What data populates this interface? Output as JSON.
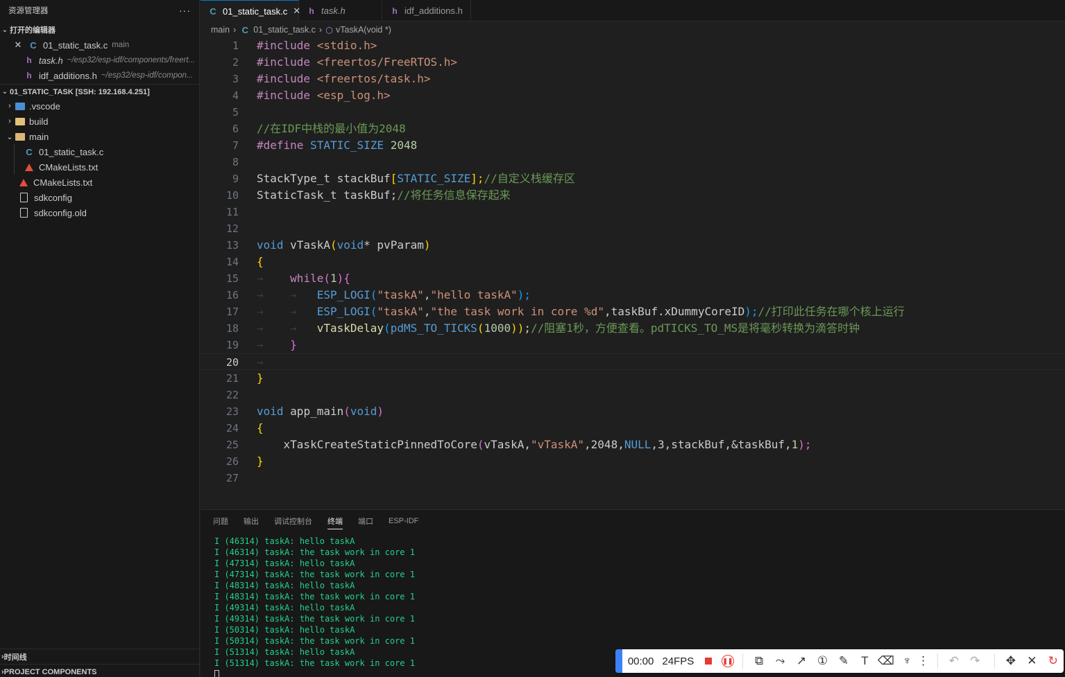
{
  "sidebar": {
    "title": "资源管理器",
    "more": "···",
    "open_editors_label": "打开的编辑器",
    "open_editors": [
      {
        "name": "01_static_task.c",
        "tag": "main",
        "icon": "c-file-icon",
        "close": "✕"
      },
      {
        "name": "task.h",
        "desc": "~/esp32/esp-idf/components/freert...",
        "icon": "h-file-icon"
      },
      {
        "name": "idf_additions.h",
        "desc": "~/esp32/esp-idf/compon...",
        "icon": "h-file-icon"
      }
    ],
    "workspace_label": "01_STATIC_TASK [SSH: 192.168.4.251]",
    "tree": [
      {
        "name": ".vscode"
      },
      {
        "name": "build"
      },
      {
        "name": "main"
      },
      {
        "name": "01_static_task.c"
      },
      {
        "name": "CMakeLists.txt"
      },
      {
        "name": "CMakeLists.txt"
      },
      {
        "name": "sdkconfig"
      },
      {
        "name": "sdkconfig.old"
      }
    ],
    "timeline_label": "时间线",
    "project_components_label": "PROJECT COMPONENTS"
  },
  "tabs": [
    {
      "label": "01_static_task.c",
      "close": "✕",
      "icon": "C"
    },
    {
      "label": "task.h",
      "icon": "h"
    },
    {
      "label": "idf_additions.h",
      "icon": "h"
    }
  ],
  "breadcrumb": {
    "folder": "main",
    "file": "01_static_task.c",
    "symbol": "vTaskA(void *)",
    "sep": "›"
  },
  "editor": {
    "line_numbers": [
      "1",
      "2",
      "3",
      "4",
      "5",
      "6",
      "7",
      "8",
      "9",
      "10",
      "11",
      "12",
      "13",
      "14",
      "15",
      "16",
      "17",
      "18",
      "19",
      "20",
      "21",
      "22",
      "23",
      "24",
      "25",
      "26",
      "27"
    ],
    "current_line": 20,
    "tokens": {
      "l1a": "#include",
      "l1b": "<stdio.h>",
      "l2a": "#include",
      "l2b": "<freertos/FreeRTOS.h>",
      "l3a": "#include",
      "l3b": "<freertos/task.h>",
      "l4a": "#include",
      "l4b": "<esp_log.h>",
      "l6": "//在IDF中栈的最小值为2048",
      "l7a": "#define",
      "l7b": "STATIC_SIZE",
      "l7c": "2048",
      "l9a": "StackType_t",
      "l9b": "stackBuf",
      "l9c": "[",
      "l9d": "STATIC_SIZE",
      "l9e": "];",
      "l9f": "//自定义栈缓存区",
      "l10a": "StaticTask_t",
      "l10b": "taskBuf;",
      "l10c": "//将任务信息保存起来",
      "l13a": "void",
      "l13b": "vTaskA",
      "l13c": "(",
      "l13d": "void",
      "l13e": "*",
      "l13f": "pvParam",
      "l13g": ")",
      "l14": "{",
      "l15a": "while",
      "l15b": "(",
      "l15c": "1",
      "l15d": ")",
      "l15e": "{",
      "l16a": "ESP_LOGI",
      "l16b": "(",
      "l16c": "\"taskA\"",
      "l16d": ",",
      "l16e": "\"hello taskA\"",
      "l16f": ");",
      "l17a": "ESP_LOGI",
      "l17b": "(",
      "l17c": "\"taskA\"",
      "l17d": ",",
      "l17e": "\"the task work in core %d\"",
      "l17f": ",taskBuf.xDummyCoreID",
      "l17g": ");",
      "l17h": "//打印此任务在哪个核上运行",
      "l18a": "vTaskDelay",
      "l18b": "(",
      "l18c": "pdMS_TO_TICKS",
      "l18d": "(",
      "l18e": "1000",
      "l18f": "))",
      "l18g": ";",
      "l18h": "//阻塞1秒，方便查看。pdTICKS_TO_MS是将毫秒转换为滴答时钟",
      "l19": "}",
      "l21": "}",
      "l23a": "void",
      "l23b": "app_main",
      "l23c": "(",
      "l23d": "void",
      "l23e": ")",
      "l24": "{",
      "l25a": "xTaskCreateStaticPinnedToCore",
      "l25b": "(",
      "l25c": "vTaskA,",
      "l25d": "\"vTaskA\"",
      "l25e": ",2048,",
      "l25f": "NULL",
      "l25g": ",3,stackBuf,&taskBuf,",
      "l25h": "1",
      "l25i": ");",
      "l26": "}",
      "indent_mark": "→"
    }
  },
  "panel": {
    "tabs": [
      "问题",
      "输出",
      "调试控制台",
      "终端",
      "端口",
      "ESP-IDF"
    ],
    "active_tab": "终端",
    "terminal_lines": [
      "I (46314) taskA: hello taskA",
      "I (46314) taskA: the task work in core 1",
      "I (47314) taskA: hello taskA",
      "I (47314) taskA: the task work in core 1",
      "I (48314) taskA: hello taskA",
      "I (48314) taskA: the task work in core 1",
      "I (49314) taskA: hello taskA",
      "I (49314) taskA: the task work in core 1",
      "I (50314) taskA: hello taskA",
      "I (50314) taskA: the task work in core 1",
      "I (51314) taskA: hello taskA",
      "I (51314) taskA: the task work in core 1"
    ]
  },
  "recorder": {
    "time": "00:00",
    "fps": "24FPS",
    "tools": [
      "shape-icon",
      "polyline-icon",
      "arrow-icon",
      "number-icon",
      "pen-icon",
      "text-icon",
      "eraser-icon",
      "highlighter-icon",
      "more-icon",
      "undo-icon",
      "redo-icon",
      "move-icon",
      "close-icon",
      "restart-icon"
    ],
    "accent": "#3b82f6",
    "record_color": "#e53935"
  }
}
